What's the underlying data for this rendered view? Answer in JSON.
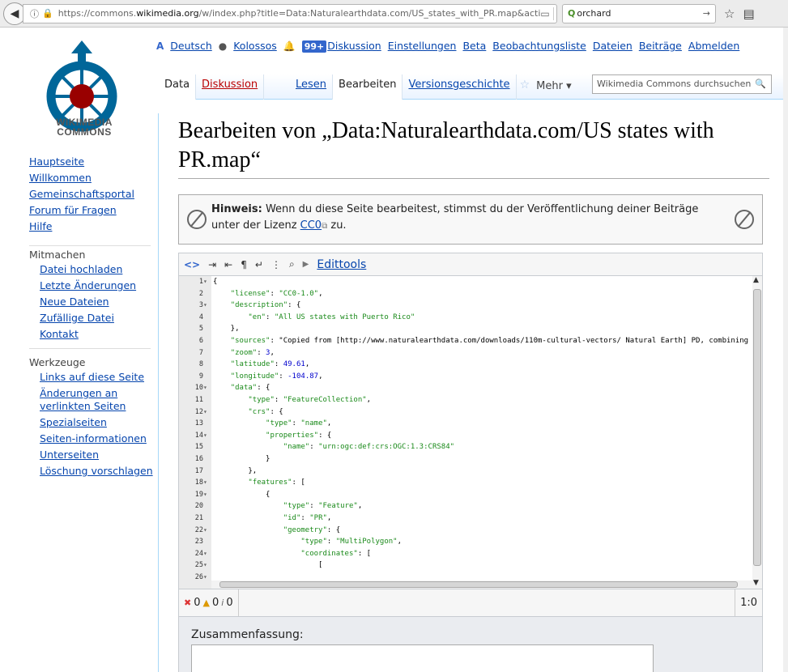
{
  "browser": {
    "url_prefix": "https://commons.",
    "url_host": "wikimedia.org",
    "url_path": "/w/index.php?title=Data:Naturalearthdata.com/US_states_with_PR.map&acti",
    "search_value": "orchard"
  },
  "logo": {
    "line1": "WIKIMEDIA",
    "line2": "COMMONS"
  },
  "personal": {
    "language": "Deutsch",
    "user": "Kolossos",
    "notifications": "99+",
    "discussion": "Diskussion",
    "settings": "Einstellungen",
    "beta": "Beta",
    "watchlist": "Beobachtungsliste",
    "files": "Dateien",
    "contributions": "Beiträge",
    "logout": "Abmelden"
  },
  "tabs": {
    "data": "Data",
    "discussion": "Diskussion",
    "read": "Lesen",
    "edit": "Bearbeiten",
    "history": "Versionsgeschichte",
    "more": "Mehr"
  },
  "search": {
    "placeholder": "Wikimedia Commons durchsuchen"
  },
  "heading": "Bearbeiten von „Data:Naturalearthdata.com/US states with PR.map“",
  "notice": {
    "label": "Hinweis:",
    "text": " Wenn du diese Seite bearbeitest, stimmst du der Veröffentlichung deiner Beiträge unter der Lizenz ",
    "link": "CC0",
    "suffix": " zu."
  },
  "sidebar": {
    "nav": [
      "Hauptseite",
      "Willkommen",
      "Gemeinschaftsportal",
      "Forum für Fragen",
      "Hilfe"
    ],
    "participate_title": "Mitmachen",
    "participate": [
      "Datei hochladen",
      "Letzte Änderungen",
      "Neue Dateien",
      "Zufällige Datei",
      "Kontakt"
    ],
    "tools_title": "Werkzeuge",
    "tools": [
      "Links auf diese Seite",
      "Änderungen an verlinkten Seiten",
      "Spezialseiten",
      "Seiten-informationen",
      "Unterseiten",
      "Löschung vorschlagen"
    ]
  },
  "editor": {
    "edittools": "Edittools",
    "lines": [
      {
        "n": "1",
        "f": "▾",
        "t": "{"
      },
      {
        "n": "2",
        "f": "",
        "t": "    \"license\": \"CC0-1.0\","
      },
      {
        "n": "3",
        "f": "▾",
        "t": "    \"description\": {"
      },
      {
        "n": "4",
        "f": "",
        "t": "        \"en\": \"All US states with Puerto Rico\""
      },
      {
        "n": "5",
        "f": "",
        "t": "    },"
      },
      {
        "n": "6",
        "f": "",
        "t": "    \"sources\": \"Copied from [http://www.naturalearthdata.com/downloads/110m-cultural-vectors/ Natural Earth] PD, combining states wi"
      },
      {
        "n": "7",
        "f": "",
        "t": "    \"zoom\": 3,"
      },
      {
        "n": "8",
        "f": "",
        "t": "    \"latitude\": 49.61,"
      },
      {
        "n": "9",
        "f": "",
        "t": "    \"longitude\": -104.87,"
      },
      {
        "n": "10",
        "f": "▾",
        "t": "    \"data\": {"
      },
      {
        "n": "11",
        "f": "",
        "t": "        \"type\": \"FeatureCollection\","
      },
      {
        "n": "12",
        "f": "▾",
        "t": "        \"crs\": {"
      },
      {
        "n": "13",
        "f": "",
        "t": "            \"type\": \"name\","
      },
      {
        "n": "14",
        "f": "▾",
        "t": "            \"properties\": {"
      },
      {
        "n": "15",
        "f": "",
        "t": "                \"name\": \"urn:ogc:def:crs:OGC:1.3:CRS84\""
      },
      {
        "n": "16",
        "f": "",
        "t": "            }"
      },
      {
        "n": "17",
        "f": "",
        "t": "        },"
      },
      {
        "n": "18",
        "f": "▾",
        "t": "        \"features\": ["
      },
      {
        "n": "19",
        "f": "▾",
        "t": "            {"
      },
      {
        "n": "20",
        "f": "",
        "t": "                \"type\": \"Feature\","
      },
      {
        "n": "21",
        "f": "",
        "t": "                \"id\": \"PR\","
      },
      {
        "n": "22",
        "f": "▾",
        "t": "                \"geometry\": {"
      },
      {
        "n": "23",
        "f": "",
        "t": "                    \"type\": \"MultiPolygon\","
      },
      {
        "n": "24",
        "f": "▾",
        "t": "                    \"coordinates\": ["
      },
      {
        "n": "25",
        "f": "▾",
        "t": "                        ["
      },
      {
        "n": "26",
        "f": "▾",
        "t": ""
      }
    ],
    "errors": "0",
    "warnings": "0",
    "infos": "0",
    "cursor": "1:0"
  },
  "summary": {
    "label": "Zusammenfassung:"
  },
  "colors": {
    "link": "#0645ad",
    "redlink": "#ba0000",
    "badge": "#3366cc"
  }
}
